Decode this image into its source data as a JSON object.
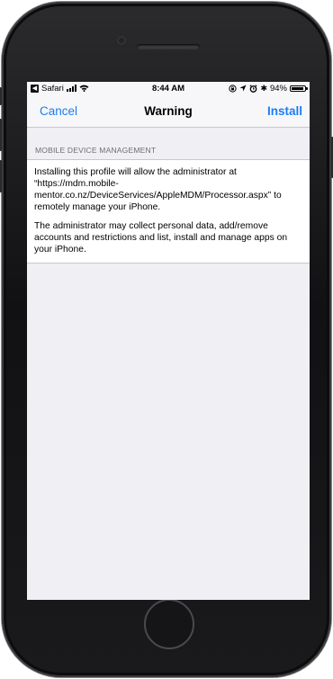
{
  "status_bar": {
    "back_app": "Safari",
    "time": "8:44 AM",
    "battery": "94%",
    "icons": [
      "signal-bars-icon",
      "wifi-icon",
      "lock-rotation-icon",
      "location-icon",
      "alarm-icon",
      "bluetooth-icon",
      "battery-icon"
    ]
  },
  "navbar": {
    "cancel_label": "Cancel",
    "title": "Warning",
    "install_label": "Install"
  },
  "section": {
    "header": "MOBILE DEVICE MANAGEMENT",
    "paragraph1": "Installing this profile will allow the administrator at “https://mdm.mobile-mentor.co.nz/DeviceServices/AppleMDM/Processor.aspx” to remotely manage your iPhone.",
    "paragraph2": "The administrator may collect personal data, add/remove accounts and restrictions and list, install and manage apps on your iPhone."
  },
  "colors": {
    "accent": "#1a7ef5",
    "background": "#efeff4",
    "header_text": "#6d6d72"
  }
}
